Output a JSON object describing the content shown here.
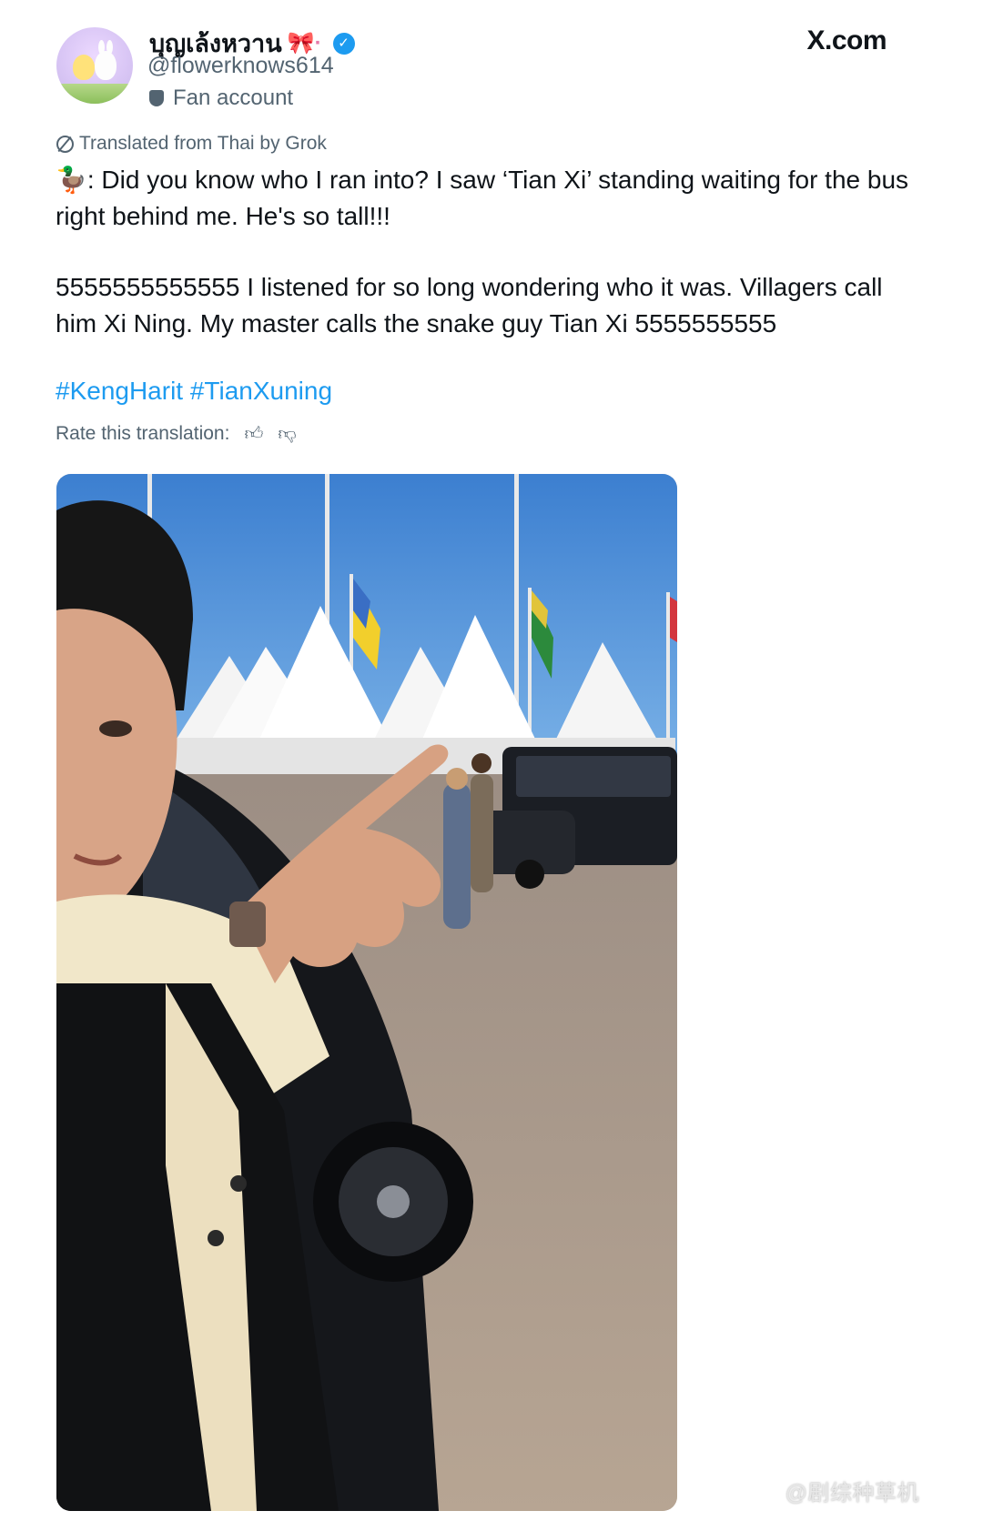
{
  "tweet": {
    "display_name": "บุญเล้งหวาน",
    "display_name_emoji": "🎀·",
    "handle": "@flowerknows614",
    "account_label": "Fan account",
    "translated_note": "Translated from Thai by Grok",
    "paragraph_1": "🦆: Did you know who I ran into? I saw ‘Tian Xi’ standing waiting for the bus right behind me. He's so tall!!!",
    "paragraph_2": "5555555555555 I listened for so long wondering who it was. Villagers call him Xi Ning. My master calls the snake guy Tian Xi 5555555555",
    "hashtags": "#KengHarit #TianXuning",
    "rate_label": "Rate this translation:"
  },
  "site_label": "X.com",
  "watermark": "@剧综种草机",
  "icons": {
    "verified": "verified-badge-icon",
    "fan_account": "shield-icon",
    "translate": "translate-icon",
    "thumbs_up": "thumbs-up-icon",
    "thumbs_down": "thumbs-down-icon"
  },
  "colors": {
    "link": "#1d9bf0",
    "secondary_text": "#536471",
    "primary_text": "#0f1419"
  }
}
